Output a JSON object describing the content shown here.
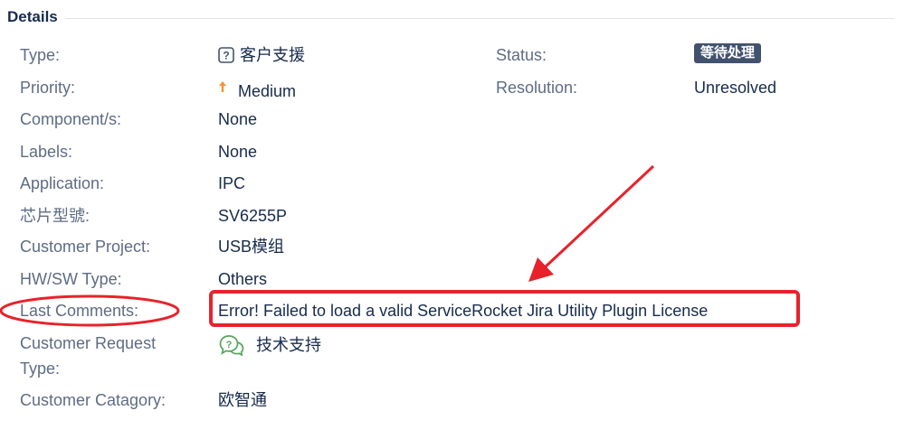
{
  "section": {
    "title": "Details"
  },
  "fields": {
    "type": {
      "label": "Type:",
      "value": "客户支援",
      "icon": "question-box-icon"
    },
    "status": {
      "label": "Status:",
      "value": "等待处理"
    },
    "priority": {
      "label": "Priority:",
      "value": "Medium",
      "icon": "arrow-up-icon"
    },
    "resolution": {
      "label": "Resolution:",
      "value": "Unresolved"
    },
    "component": {
      "label": "Component/s:",
      "value": "None"
    },
    "labels": {
      "label": "Labels:",
      "value": "None"
    },
    "application": {
      "label": "Application:",
      "value": "IPC"
    },
    "chip_model": {
      "label": "芯片型號:",
      "value": "SV6255P"
    },
    "customer_project": {
      "label": "Customer Project:",
      "value": "USB模组"
    },
    "hw_sw_type": {
      "label": "HW/SW Type:",
      "value": "Others"
    },
    "last_comments": {
      "label": "Last Comments:",
      "value": "Error! Failed to load a valid ServiceRocket Jira Utility Plugin License"
    },
    "customer_request_type": {
      "label_line1": "Customer Request",
      "label_line2": "Type:",
      "value": "技术支持",
      "icon": "help-chat-icon"
    },
    "customer_category": {
      "label": "Customer Catagory:",
      "value": "欧智通"
    }
  },
  "colors": {
    "label_text": "#5e6c84",
    "value_text": "#172b4d",
    "status_lozenge": "#42526e",
    "annotation_red": "#e8222b",
    "priority_medium": "#f79232",
    "request_type_icon": "#57a55a"
  }
}
